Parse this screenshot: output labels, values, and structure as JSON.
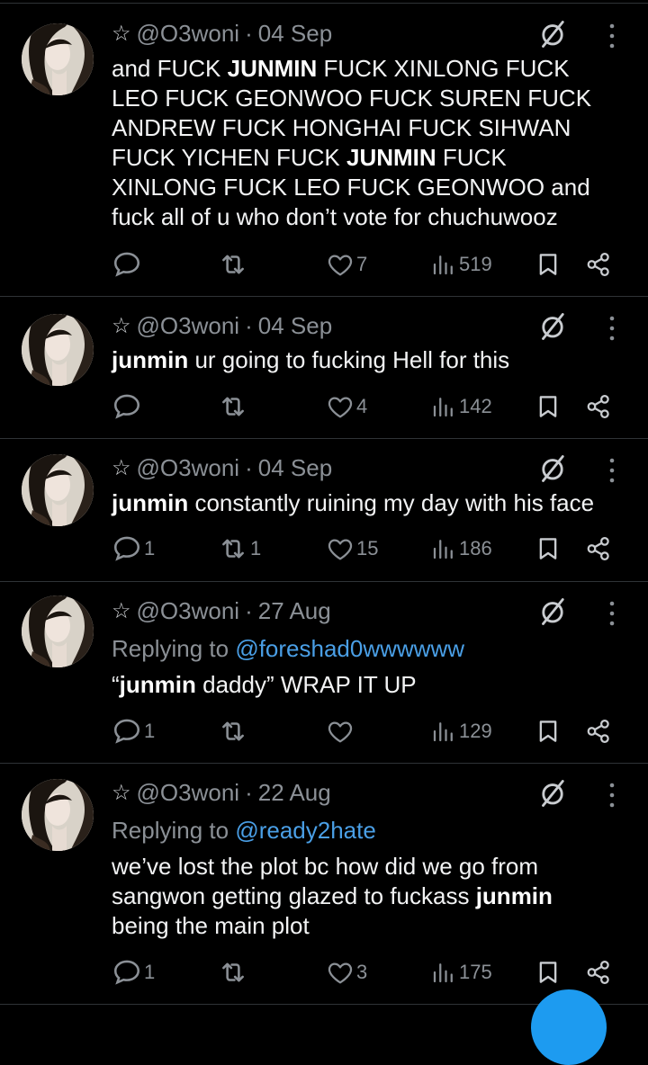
{
  "tweets": [
    {
      "star": "☆",
      "handle": "@O3woni",
      "sep": "·",
      "date": "04 Sep",
      "body_parts": [
        {
          "text": "and FUCK ",
          "bold": false
        },
        {
          "text": "JUNMIN",
          "bold": true
        },
        {
          "text": " FUCK XINLONG FUCK LEO FUCK GEONWOO FUCK SUREN FUCK ANDREW FUCK HONGHAI FUCK SIHWAN FUCK YICHEN FUCK ",
          "bold": false
        },
        {
          "text": "JUNMIN",
          "bold": true
        },
        {
          "text": " FUCK XINLONG FUCK LEO FUCK GEONWOO and fuck all of u who don’t vote for chuchuwooz",
          "bold": false
        }
      ],
      "replies": "",
      "reposts": "",
      "likes": "7",
      "views": "519"
    },
    {
      "star": "☆",
      "handle": "@O3woni",
      "sep": "·",
      "date": "04 Sep",
      "body_parts": [
        {
          "text": "junmin",
          "bold": true
        },
        {
          "text": " ur going to fucking Hell for this",
          "bold": false
        }
      ],
      "replies": "",
      "reposts": "",
      "likes": "4",
      "views": "142"
    },
    {
      "star": "☆",
      "handle": "@O3woni",
      "sep": "·",
      "date": "04 Sep",
      "body_parts": [
        {
          "text": "junmin",
          "bold": true
        },
        {
          "text": " constantly ruining my day with his face",
          "bold": false
        }
      ],
      "replies": "1",
      "reposts": "1",
      "likes": "15",
      "views": "186"
    },
    {
      "star": "☆",
      "handle": "@O3woni",
      "sep": "·",
      "date": "27 Aug",
      "replying_label": "Replying to",
      "replying_to": "@foreshad0wwwwww",
      "body_parts": [
        {
          "text": "“",
          "bold": false
        },
        {
          "text": "junmin",
          "bold": true
        },
        {
          "text": " daddy” WRAP IT UP",
          "bold": false
        }
      ],
      "replies": "1",
      "reposts": "",
      "likes": "",
      "views": "129"
    },
    {
      "star": "☆",
      "handle": "@O3woni",
      "sep": "·",
      "date": "22 Aug",
      "replying_label": "Replying to",
      "replying_to": "@ready2hate",
      "body_parts": [
        {
          "text": "we’ve lost the plot bc how did we go from sangwon getting glazed to fuckass ",
          "bold": false
        },
        {
          "text": "junmin",
          "bold": true
        },
        {
          "text": " being the main plot",
          "bold": false
        }
      ],
      "replies": "1",
      "reposts": "",
      "likes": "3",
      "views": "175"
    }
  ],
  "colors": {
    "background": "#000000",
    "text": "#e7e9ea",
    "muted": "#8b9096",
    "link": "#4a9fe6",
    "divider": "#2f3336",
    "accent": "#1d9bf0"
  },
  "icons": [
    "star-icon",
    "mute-icon",
    "more-icon",
    "reply-icon",
    "repost-icon",
    "like-icon",
    "views-icon",
    "bookmark-icon",
    "share-icon"
  ]
}
